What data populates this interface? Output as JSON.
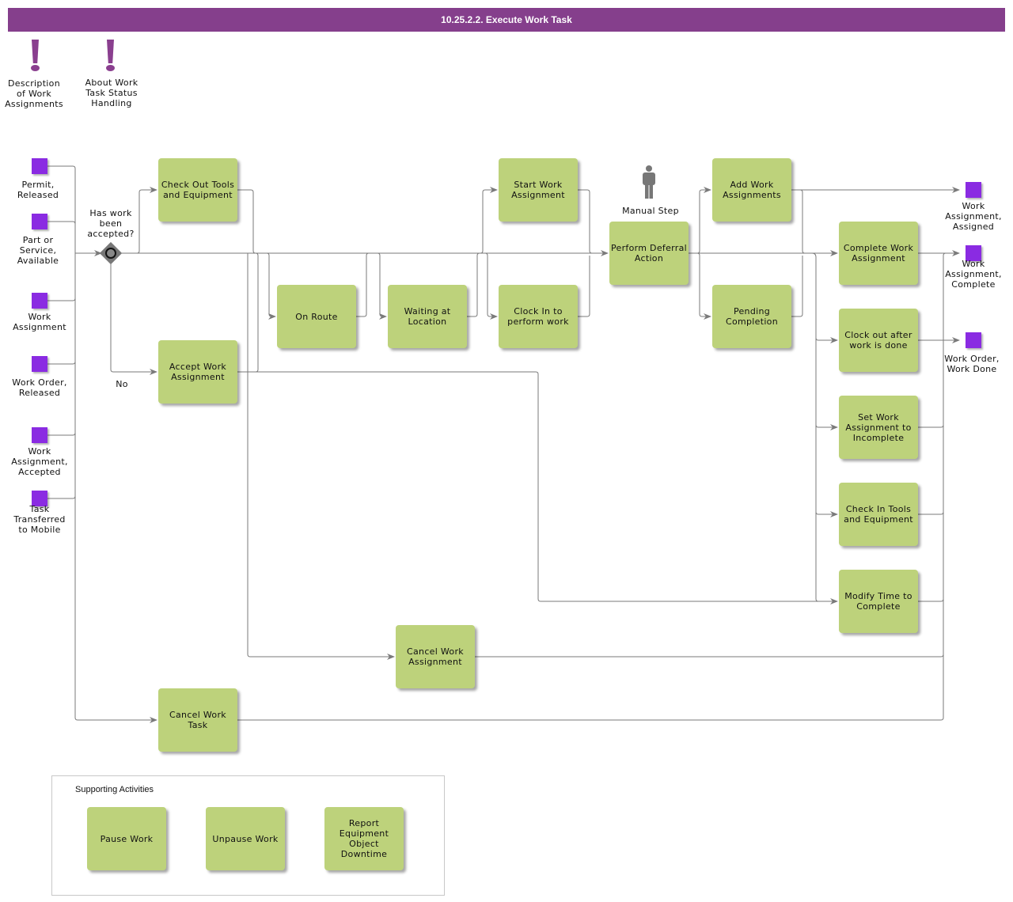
{
  "title": "10.25.2.2. Execute Work Task",
  "notes": [
    {
      "label": "Description\nof Work\nAssignments",
      "icon": "exclamation-icon"
    },
    {
      "label": "About Work\nTask Status\nHandling",
      "icon": "exclamation-icon"
    }
  ],
  "start_events": [
    {
      "label": "Permit,\nReleased"
    },
    {
      "label": "Part or\nService,\nAvailable"
    },
    {
      "label": "Work\nAssignment"
    },
    {
      "label": "Work Order,\nReleased"
    },
    {
      "label": "Work\nAssignment,\nAccepted"
    },
    {
      "label": "Task\nTransferred\nto Mobile"
    }
  ],
  "gateway": {
    "question": "Has work\nbeen\naccepted?",
    "no_label": "No"
  },
  "tasks": {
    "check_out_tools": "Check Out Tools and Equipment",
    "accept_work_assignment": "Accept Work Assignment",
    "on_route": "On Route",
    "waiting_at_location": "Waiting at Location",
    "start_work_assignment": "Start Work Assignment",
    "clock_in": "Clock In to perform work",
    "perform_deferral_action": "Perform Deferral Action",
    "add_work_assignments": "Add Work Assignments",
    "pending_completion": "Pending Completion",
    "complete_work_assignment": "Complete Work Assignment",
    "clock_out": "Clock out after work is done",
    "set_incomplete": "Set Work Assignment to Incomplete",
    "check_in_tools": "Check In Tools and Equipment",
    "modify_time": "Modify Time to Complete",
    "cancel_work_assignment": "Cancel Work Assignment",
    "cancel_work_task": "Cancel Work Task"
  },
  "manual_step": {
    "label": "Manual Step",
    "icon": "person-icon"
  },
  "end_events": [
    {
      "label": "Work\nAssignment,\nAssigned"
    },
    {
      "label": "Work\nAssignment,\nComplete"
    },
    {
      "label": "Work Order,\nWork Done"
    }
  ],
  "supporting": {
    "title": "Supporting Activities",
    "items": [
      "Pause Work",
      "Unpause Work",
      "Report Equipment Object Downtime"
    ]
  },
  "colors": {
    "header": "#853f8c",
    "task": "#bdd27b",
    "event": "#8a2be2",
    "connector": "#7a7a7a"
  }
}
